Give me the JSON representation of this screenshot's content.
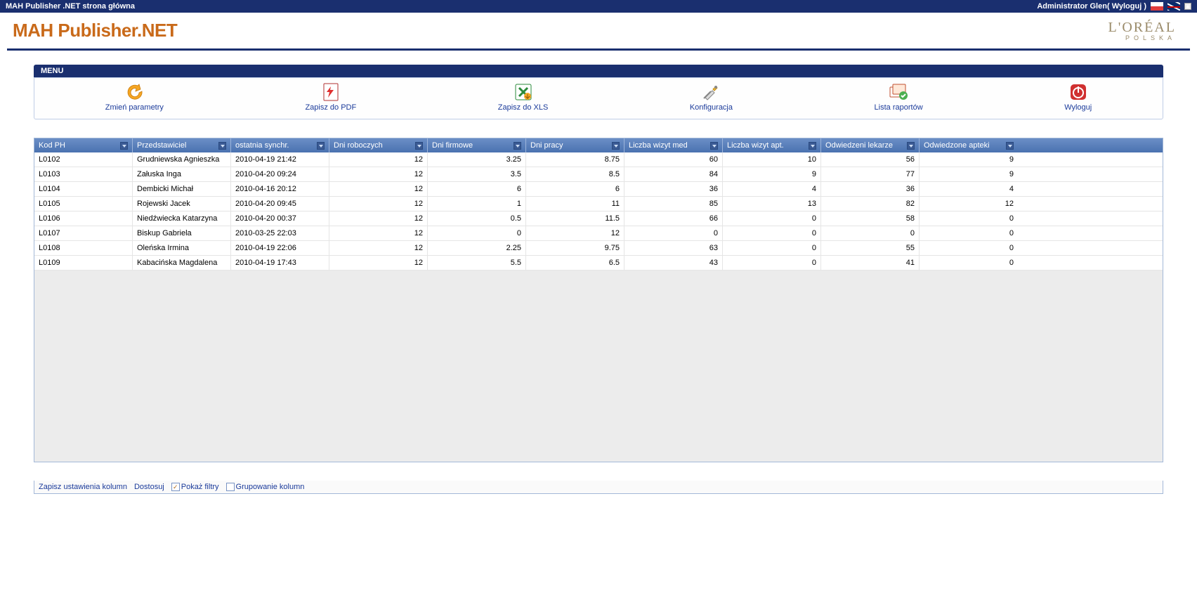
{
  "topbar": {
    "title": "MAH Publisher .NET strona główna",
    "admin": "Administrator Glen",
    "logout": "Wyloguj"
  },
  "header": {
    "app_title": "MAH Publisher.NET",
    "brand_main": "L'ORÉAL",
    "brand_sub": "POLSKA"
  },
  "menu": {
    "heading": "MENU",
    "items": [
      {
        "label": "Zmień parametry",
        "icon": "change-params"
      },
      {
        "label": "Zapisz do PDF",
        "icon": "save-pdf"
      },
      {
        "label": "Zapisz do XLS",
        "icon": "save-xls"
      },
      {
        "label": "Konfiguracja",
        "icon": "settings"
      },
      {
        "label": "Lista raportów",
        "icon": "report-list"
      },
      {
        "label": "Wyloguj",
        "icon": "logout"
      }
    ]
  },
  "grid": {
    "columns": [
      "Kod PH",
      "Przedstawiciel",
      "ostatnia synchr.",
      "Dni roboczych",
      "Dni firmowe",
      "Dni pracy",
      "Liczba wizyt med",
      "Liczba wizyt apt.",
      "Odwiedzeni lekarze",
      "Odwiedzone apteki"
    ],
    "column_align": [
      "left",
      "left",
      "left",
      "right",
      "right",
      "right",
      "right",
      "right",
      "right",
      "right"
    ],
    "rows": [
      [
        "L0102",
        "Grudniewska Agnieszka",
        "2010-04-19 21:42",
        "12",
        "3.25",
        "8.75",
        "60",
        "10",
        "56",
        "9"
      ],
      [
        "L0103",
        "Załuska Inga",
        "2010-04-20 09:24",
        "12",
        "3.5",
        "8.5",
        "84",
        "9",
        "77",
        "9"
      ],
      [
        "L0104",
        "Dembicki Michał",
        "2010-04-16 20:12",
        "12",
        "6",
        "6",
        "36",
        "4",
        "36",
        "4"
      ],
      [
        "L0105",
        "Rojewski Jacek",
        "2010-04-20 09:45",
        "12",
        "1",
        "11",
        "85",
        "13",
        "82",
        "12"
      ],
      [
        "L0106",
        "Niedźwiecka Katarzyna",
        "2010-04-20 00:37",
        "12",
        "0.5",
        "11.5",
        "66",
        "0",
        "58",
        "0"
      ],
      [
        "L0107",
        "Biskup Gabriela",
        "2010-03-25 22:03",
        "12",
        "0",
        "12",
        "0",
        "0",
        "0",
        "0"
      ],
      [
        "L0108",
        "Oleńska Irmina",
        "2010-04-19 22:06",
        "12",
        "2.25",
        "9.75",
        "63",
        "0",
        "55",
        "0"
      ],
      [
        "L0109",
        "Kabacińska Magdalena",
        "2010-04-19 17:43",
        "12",
        "5.5",
        "6.5",
        "43",
        "0",
        "41",
        "0"
      ]
    ]
  },
  "footer": {
    "save_cols": "Zapisz ustawienia kolumn",
    "customize": "Dostosuj",
    "show_filters": "Pokaż filtry",
    "group_cols": "Grupowanie kolumn"
  }
}
